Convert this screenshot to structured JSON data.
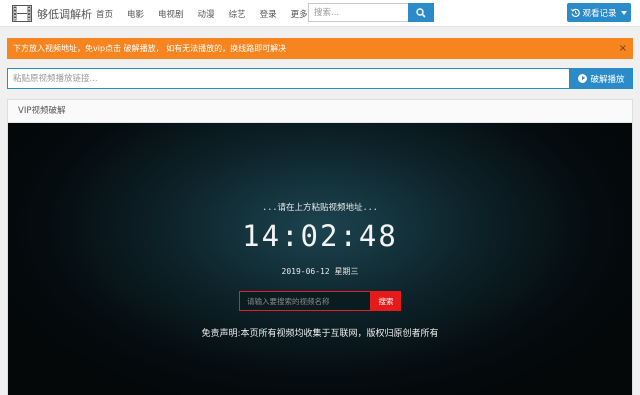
{
  "header": {
    "logo_text": "够低调解析",
    "nav": [
      "首页",
      "电影",
      "电视剧",
      "动漫",
      "综艺",
      "登录"
    ],
    "more_label": "更多",
    "search_placeholder": "搜索...",
    "record_label": "观看记录"
  },
  "alert": {
    "text": "下方放入视频地址，免vip点击 破解播放， 如有无法播放的，换线路即可解决",
    "close": "×"
  },
  "parse": {
    "placeholder": "粘贴原视频播放链接...",
    "button_label": "破解播放"
  },
  "panel": {
    "title": "VIP视频破解"
  },
  "player": {
    "hint": "...请在上方粘贴视频地址...",
    "time": "14:02:48",
    "date": "2019-06-12 星期三",
    "search_placeholder": "请输入要搜索的视频名称",
    "search_button": "搜索",
    "disclaimer": "免责声明:本页所有视频均收集于互联网，版权归原创者所有"
  },
  "colors": {
    "accent": "#2b8bc9",
    "alert": "#f6841f",
    "search_red": "#e51b1b"
  }
}
